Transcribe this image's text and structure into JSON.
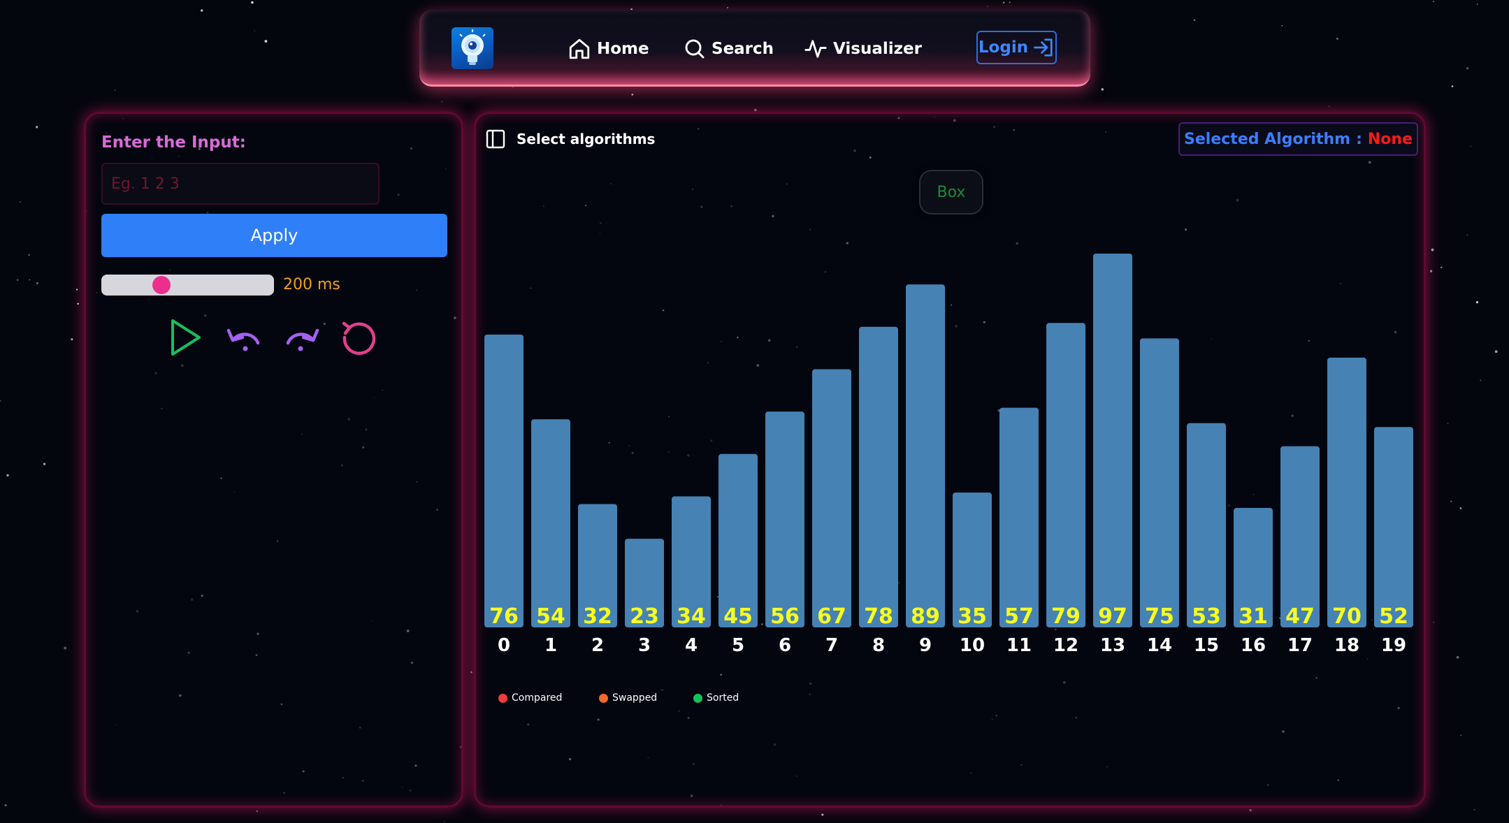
{
  "navbar": {
    "items": [
      {
        "label": "Home",
        "icon": "home-icon"
      },
      {
        "label": "Search",
        "icon": "search-icon"
      },
      {
        "label": "Visualizer",
        "icon": "activity-icon"
      }
    ],
    "login_label": "Login"
  },
  "input_panel": {
    "label": "Enter the Input:",
    "placeholder": "Eg. 1 2 3",
    "value": "",
    "apply_label": "Apply",
    "speed_label": "200 ms",
    "controls": [
      "play-icon",
      "undo-icon",
      "redo-icon",
      "reset-icon"
    ]
  },
  "visualizer": {
    "select_algorithms_label": "Select algorithms",
    "selected_algorithm_label": "Selected Algorithm",
    "selected_separator": ":",
    "selected_algorithm_value": "None",
    "mode_button_label": "Box",
    "legend": [
      {
        "label": "Compared",
        "color": "#ef3b3b"
      },
      {
        "label": "Swapped",
        "color": "#f26a2a"
      },
      {
        "label": "Sorted",
        "color": "#18c05a"
      }
    ]
  },
  "colors": {
    "bar": "#4682b4",
    "bar_value": "#f7ff1f",
    "accent": "#2f7ff8",
    "glow": "#ff1e6e"
  },
  "chart_data": {
    "type": "bar",
    "categories": [
      "0",
      "1",
      "2",
      "3",
      "4",
      "5",
      "6",
      "7",
      "8",
      "9",
      "10",
      "11",
      "12",
      "13",
      "14",
      "15",
      "16",
      "17",
      "18",
      "19"
    ],
    "values": [
      76,
      54,
      32,
      23,
      34,
      45,
      56,
      67,
      78,
      89,
      35,
      57,
      79,
      97,
      75,
      53,
      31,
      47,
      70,
      52
    ],
    "title": "",
    "xlabel": "",
    "ylabel": "",
    "grid": false
  }
}
